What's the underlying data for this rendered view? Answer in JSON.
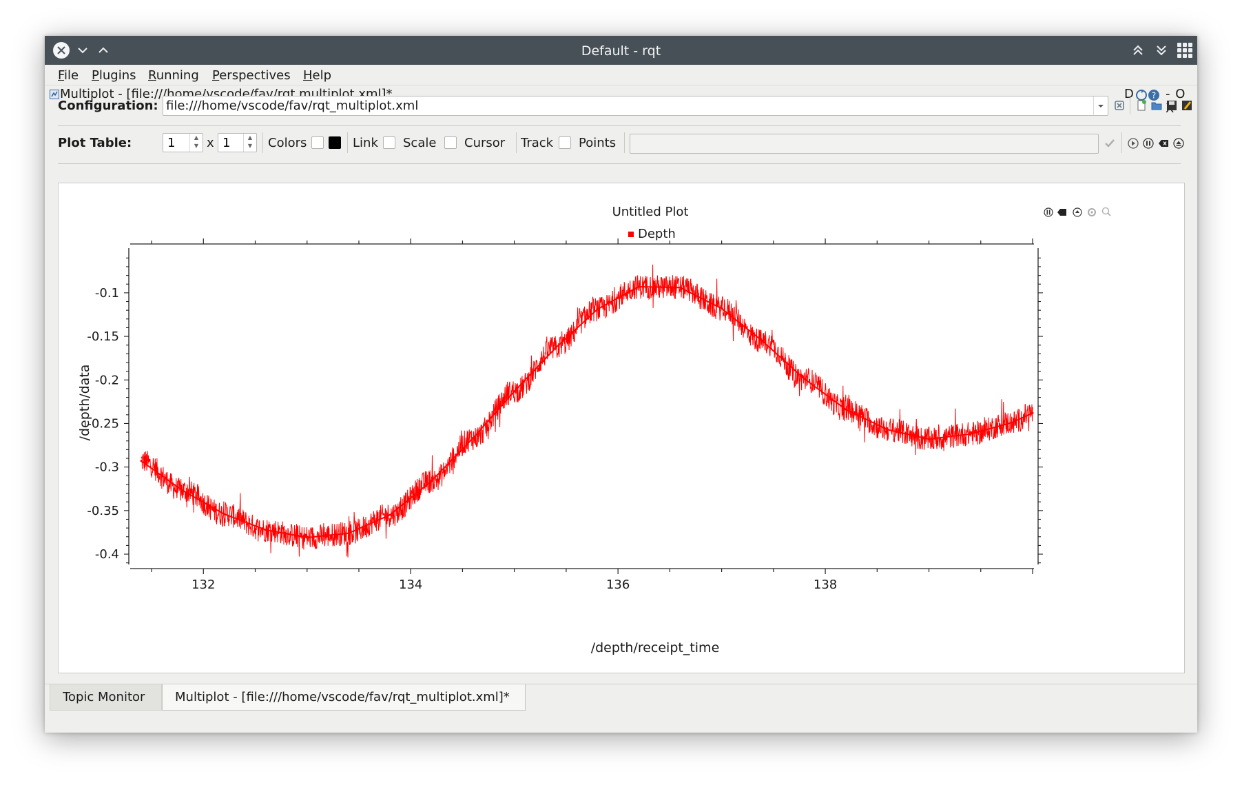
{
  "window": {
    "title": "Default - rqt",
    "accent": "#475057"
  },
  "menu": [
    "File",
    "Plugins",
    "Running",
    "Perspectives",
    "Help"
  ],
  "dock": {
    "title": "Multiplot - [file:///home/vscode/fav/rqt  multiplot.xml]*",
    "right_letter": "D",
    "right_controls": "- O X"
  },
  "configuration": {
    "label": "Configuration:",
    "value": "file:///home/vscode/fav/rqt_multiplot.xml"
  },
  "plot_table": {
    "label": "Plot Table:",
    "rows": "1",
    "x_label": "x",
    "cols": "1",
    "colors_label": "Colors",
    "link_label": "Link",
    "scale_label": "Scale",
    "cursor_label": "Cursor",
    "track_label": "Track",
    "points_label": "Points"
  },
  "tabs": [
    {
      "label": "Topic Monitor",
      "active": false
    },
    {
      "label": "Multiplot - [file:///home/vscode/fav/rqt_multiplot.xml]*",
      "active": true
    }
  ],
  "chart_data": {
    "type": "line",
    "title": "Untitled Plot",
    "xlabel": "/depth/receipt_time",
    "ylabel": "/depth/data",
    "xlim": [
      131.4,
      140.0
    ],
    "ylim": [
      -0.415,
      -0.055
    ],
    "xticks": [
      132,
      134,
      136,
      138
    ],
    "xtick_labels": [
      "132",
      "134",
      "136",
      "138"
    ],
    "yticks": [
      -0.1,
      -0.15,
      -0.2,
      -0.25,
      -0.3,
      -0.35,
      -0.4
    ],
    "ytick_labels": [
      "-0.1",
      "-0.15",
      "-0.2",
      "-0.25",
      "-0.3",
      "-0.35",
      "-0.4"
    ],
    "legend_position": "top-center",
    "grid": false,
    "series": [
      {
        "name": "Depth",
        "color": "#ff0000",
        "x": [
          131.4,
          131.8,
          132.2,
          132.6,
          133.0,
          133.4,
          133.8,
          134.2,
          134.6,
          135.0,
          135.4,
          135.8,
          136.2,
          136.6,
          137.0,
          137.4,
          137.8,
          138.2,
          138.6,
          139.0,
          139.4,
          139.8,
          140.0
        ],
        "y": [
          -0.293,
          -0.327,
          -0.354,
          -0.372,
          -0.381,
          -0.376,
          -0.355,
          -0.316,
          -0.267,
          -0.213,
          -0.163,
          -0.119,
          -0.093,
          -0.094,
          -0.118,
          -0.156,
          -0.199,
          -0.234,
          -0.257,
          -0.268,
          -0.262,
          -0.249,
          -0.238
        ]
      }
    ]
  }
}
